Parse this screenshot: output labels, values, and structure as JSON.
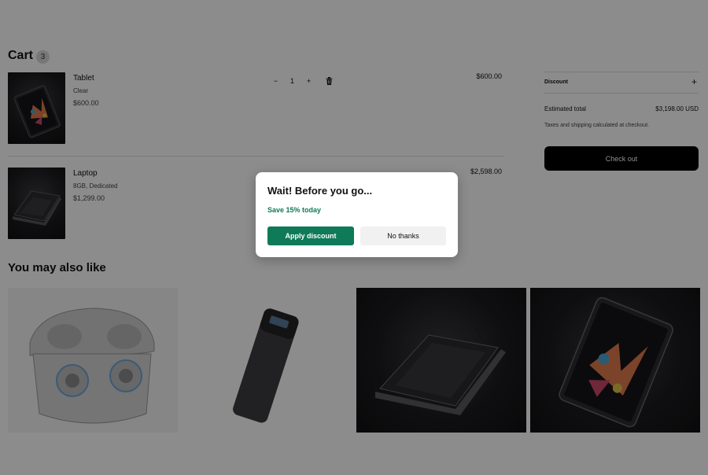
{
  "cart": {
    "title": "Cart",
    "count": "3",
    "items": [
      {
        "name": "Tablet",
        "variant": "Clear",
        "unit_price": "$600.00",
        "quantity": "1",
        "line_total": "$600.00",
        "image_icon": "tablet-image"
      },
      {
        "name": "Laptop",
        "variant": "8GB,  Dedicated",
        "unit_price": "$1,299.00",
        "line_total": "$2,598.00",
        "image_icon": "laptop-image"
      }
    ],
    "qty_minus": "−",
    "qty_plus": "+"
  },
  "summary": {
    "discount_label": "Discount",
    "discount_toggle": "+",
    "estimated_label": "Estimated total",
    "estimated_value": "$3,198.00 USD",
    "tax_note": "Taxes and shipping calculated at checkout.",
    "checkout_label": "Check out"
  },
  "recommendations": {
    "title": "You may also like",
    "items": [
      {
        "icon": "earbuds-image"
      },
      {
        "icon": "power-bank-image"
      },
      {
        "icon": "laptop-image"
      },
      {
        "icon": "tablet-image"
      }
    ]
  },
  "modal": {
    "title": "Wait! Before you go...",
    "subtitle": "Save 15% today",
    "apply_label": "Apply discount",
    "decline_label": "No thanks",
    "accent_color": "#0f7a57"
  }
}
